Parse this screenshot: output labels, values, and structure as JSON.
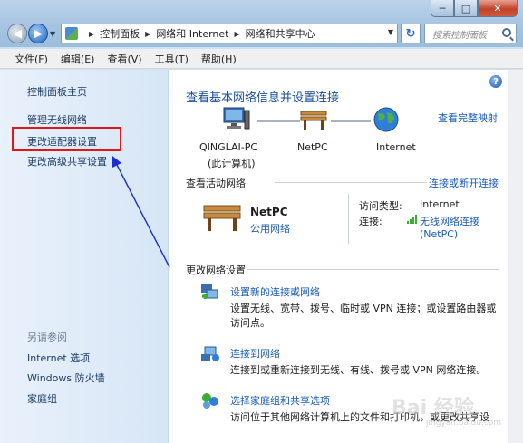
{
  "window": {
    "controls": {
      "minimize": "─",
      "maximize": "□",
      "close": "✕"
    }
  },
  "toolbar": {
    "back_icon": "back-arrow-icon",
    "forward_icon": "forward-arrow-icon",
    "breadcrumb": [
      "控制面板",
      "网络和 Internet",
      "网络和共享中心"
    ],
    "refresh_icon": "refresh-icon",
    "search_placeholder": "搜索控制面板"
  },
  "menu": [
    "文件(F)",
    "编辑(E)",
    "查看(V)",
    "工具(T)",
    "帮助(H)"
  ],
  "sidebar": {
    "home": "控制面板主页",
    "links": [
      "管理无线网络",
      "更改适配器设置",
      "更改高级共享设置"
    ],
    "see_also_title": "另请参阅",
    "see_also": [
      "Internet 选项",
      "Windows 防火墙",
      "家庭组"
    ]
  },
  "main": {
    "title": "查看基本网络信息并设置连接",
    "full_map": "查看完整映射",
    "map": {
      "computer": "QINGLAI-PC",
      "computer_sub": "(此计算机)",
      "network": "NetPC",
      "internet": "Internet"
    },
    "active_title": "查看活动网络",
    "connect_link": "连接或断开连接",
    "active": {
      "name": "NetPC",
      "type": "公用网络",
      "access_label": "访问类型:",
      "access_value": "Internet",
      "conn_label": "连接:",
      "conn_value": "无线网络连接",
      "conn_value2": "(NetPC)"
    },
    "change_title": "更改网络设置",
    "tasks": [
      {
        "link": "设置新的连接或网络",
        "desc": "设置无线、宽带、拨号、临时或 VPN 连接；或设置路由器或访问点。"
      },
      {
        "link": "连接到网络",
        "desc": "连接到或重新连接到无线、有线、拨号或 VPN 网络连接。"
      },
      {
        "link": "选择家庭组和共享选项",
        "desc": "访问位于其他网络计算机上的文件和打印机，或更改共享设"
      }
    ]
  },
  "watermark": {
    "text": "Bai 经验",
    "sub": "jingyan.baidu.com"
  },
  "colors": {
    "link": "#1a5bb8",
    "highlight_box": "#e11616",
    "annotation_arrow": "#1a2fd6"
  }
}
